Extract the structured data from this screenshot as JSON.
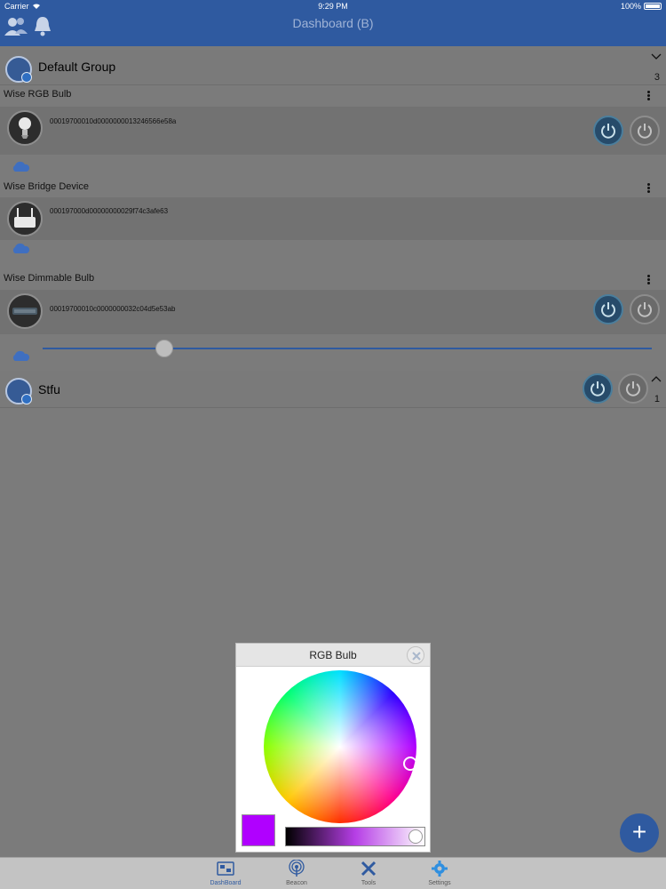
{
  "status_bar": {
    "carrier": "Carrier",
    "time": "9:29 PM",
    "battery": "100%"
  },
  "nav": {
    "title": "Dashboard (B)"
  },
  "groups": [
    {
      "name": "Default Group",
      "count": "3",
      "devices": [
        {
          "title": "Wise RGB Bulb",
          "id": "00019700010d0000000013246566e58a"
        },
        {
          "title": "Wise Bridge Device",
          "id": "000197000d00000000029f74c3afe63"
        },
        {
          "title": "Wise Dimmable Bulb",
          "id": "00019700010c0000000032c04d5e53ab",
          "brightness_pct": 20
        }
      ]
    },
    {
      "name": "Stfu",
      "count": "1"
    }
  ],
  "popup": {
    "title": "RGB Bulb",
    "selected_color": "#b000ff",
    "brightness_level": 1.0
  },
  "fab": {
    "label": "+"
  },
  "tabs": [
    {
      "label": "DashBoard",
      "active": true
    },
    {
      "label": "Beacon"
    },
    {
      "label": "Tools"
    },
    {
      "label": "Settings"
    }
  ],
  "colors": {
    "brand": "#2f5aa0",
    "power_on": "#274b6a",
    "power_off": "#6a6a6a"
  }
}
